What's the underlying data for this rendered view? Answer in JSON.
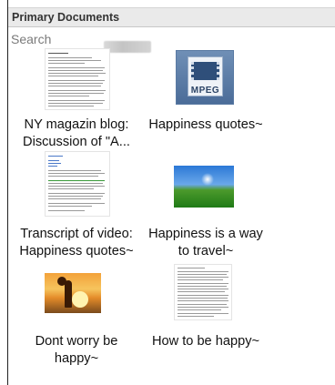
{
  "panel": {
    "title": "Primary Documents",
    "search": {
      "placeholder": "Search",
      "value": ""
    }
  },
  "documents": [
    {
      "label_line1": "NY magazin blog:",
      "label_line2": "Discussion of \"A...",
      "thumbnail": "document-page"
    },
    {
      "label_line1": "Happiness quotes~",
      "label_line2": "",
      "thumbnail": "mpeg-video-file-icon"
    },
    {
      "label_line1": "Transcript of video:",
      "label_line2": "Happiness quotes~",
      "thumbnail": "document-page"
    },
    {
      "label_line1": "Happiness is a way",
      "label_line2": "to travel~",
      "thumbnail": "landscape-photo"
    },
    {
      "label_line1": "Dont worry be",
      "label_line2": "happy~",
      "thumbnail": "sunset-photo"
    },
    {
      "label_line1": "How to be happy~",
      "label_line2": "",
      "thumbnail": "document-page"
    }
  ],
  "icons": {
    "mpeg_tag": "MPEG"
  },
  "colors": {
    "header_bg": "#eaeaea",
    "mpeg_blue": "#4b6c98",
    "sky": "#2b78d6",
    "grass": "#1f7a16",
    "sunset": "#f3a23a"
  }
}
